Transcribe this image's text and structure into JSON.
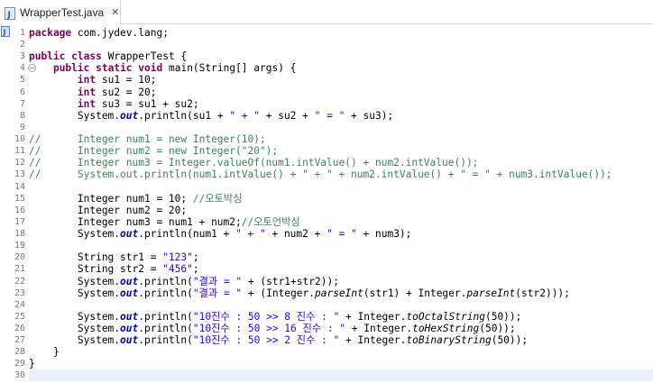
{
  "tab": {
    "title": "WrapperTest.java",
    "close_symbol": "✕",
    "icon": "java-file-icon"
  },
  "colors": {
    "keyword": "#7f0055",
    "string": "#2a00ff",
    "comment": "#3f7f5f",
    "field": "#0000c0",
    "current_line": "#e8f2fe"
  },
  "lines": [
    {
      "n": "1",
      "t": [
        {
          "c": "kw",
          "v": "package"
        },
        {
          "c": "",
          "v": " com.jydev.lang;"
        }
      ]
    },
    {
      "n": "2",
      "t": []
    },
    {
      "n": "3",
      "t": [
        {
          "c": "kw",
          "v": "public"
        },
        {
          "c": "",
          "v": " "
        },
        {
          "c": "kw",
          "v": "class"
        },
        {
          "c": "",
          "v": " WrapperTest {"
        }
      ]
    },
    {
      "n": "4",
      "fold": "⊖",
      "t": [
        {
          "c": "",
          "v": "    "
        },
        {
          "c": "kw",
          "v": "public"
        },
        {
          "c": "",
          "v": " "
        },
        {
          "c": "kw",
          "v": "static"
        },
        {
          "c": "",
          "v": " "
        },
        {
          "c": "kw",
          "v": "void"
        },
        {
          "c": "",
          "v": " main(String[] args) {"
        }
      ]
    },
    {
      "n": "5",
      "t": [
        {
          "c": "",
          "v": "        "
        },
        {
          "c": "kw",
          "v": "int"
        },
        {
          "c": "",
          "v": " su1 = 10;"
        }
      ]
    },
    {
      "n": "6",
      "t": [
        {
          "c": "",
          "v": "        "
        },
        {
          "c": "kw",
          "v": "int"
        },
        {
          "c": "",
          "v": " su2 = 20;"
        }
      ]
    },
    {
      "n": "7",
      "t": [
        {
          "c": "",
          "v": "        "
        },
        {
          "c": "kw",
          "v": "int"
        },
        {
          "c": "",
          "v": " su3 = su1 + su2;"
        }
      ]
    },
    {
      "n": "8",
      "t": [
        {
          "c": "",
          "v": "        System."
        },
        {
          "c": "fld",
          "v": "out"
        },
        {
          "c": "",
          "v": ".println(su1 + "
        },
        {
          "c": "str",
          "v": "\" + \""
        },
        {
          "c": "",
          "v": " + su2 + "
        },
        {
          "c": "str",
          "v": "\" = \""
        },
        {
          "c": "",
          "v": " + su3);"
        }
      ]
    },
    {
      "n": "9",
      "t": []
    },
    {
      "n": "10",
      "t": [
        {
          "c": "cm",
          "v": "//      Integer num1 = new Integer(10);"
        }
      ]
    },
    {
      "n": "11",
      "t": [
        {
          "c": "cm",
          "v": "//      Integer num2 = new Integer(\"20\");"
        }
      ]
    },
    {
      "n": "12",
      "t": [
        {
          "c": "cm",
          "v": "//      Integer num3 = Integer.valueOf(num1.intValue() + num2.intValue());"
        }
      ]
    },
    {
      "n": "13",
      "t": [
        {
          "c": "cm",
          "v": "//      System.out.println(num1.intValue() + \" + \" + num2.intValue() + \" = \" + num3.intValue());"
        }
      ]
    },
    {
      "n": "14",
      "t": []
    },
    {
      "n": "15",
      "t": [
        {
          "c": "",
          "v": "        Integer num1 = 10; "
        },
        {
          "c": "cm",
          "v": "//오토박싱"
        }
      ]
    },
    {
      "n": "16",
      "t": [
        {
          "c": "",
          "v": "        Integer num2 = 20;"
        }
      ]
    },
    {
      "n": "17",
      "t": [
        {
          "c": "",
          "v": "        Integer num3 = num1 + num2;"
        },
        {
          "c": "cm",
          "v": "//오토언박싱"
        }
      ]
    },
    {
      "n": "18",
      "t": [
        {
          "c": "",
          "v": "        System."
        },
        {
          "c": "fld",
          "v": "out"
        },
        {
          "c": "",
          "v": ".println(num1 + "
        },
        {
          "c": "str",
          "v": "\" + \""
        },
        {
          "c": "",
          "v": " + num2 + "
        },
        {
          "c": "str",
          "v": "\" = \""
        },
        {
          "c": "",
          "v": " + num3);"
        }
      ]
    },
    {
      "n": "19",
      "t": []
    },
    {
      "n": "20",
      "t": [
        {
          "c": "",
          "v": "        String str1 = "
        },
        {
          "c": "str",
          "v": "\"123\""
        },
        {
          "c": "",
          "v": ";"
        }
      ]
    },
    {
      "n": "21",
      "t": [
        {
          "c": "",
          "v": "        String str2 = "
        },
        {
          "c": "str",
          "v": "\"456\""
        },
        {
          "c": "",
          "v": ";"
        }
      ]
    },
    {
      "n": "22",
      "t": [
        {
          "c": "",
          "v": "        System."
        },
        {
          "c": "fld",
          "v": "out"
        },
        {
          "c": "",
          "v": ".println("
        },
        {
          "c": "str",
          "v": "\"결과 = \""
        },
        {
          "c": "",
          "v": " + (str1+str2));"
        }
      ]
    },
    {
      "n": "23",
      "t": [
        {
          "c": "",
          "v": "        System."
        },
        {
          "c": "fld",
          "v": "out"
        },
        {
          "c": "",
          "v": ".println("
        },
        {
          "c": "str",
          "v": "\"결과 = \""
        },
        {
          "c": "",
          "v": " + (Integer."
        },
        {
          "c": "sm",
          "v": "parseInt"
        },
        {
          "c": "",
          "v": "(str1) + Integer."
        },
        {
          "c": "sm",
          "v": "parseInt"
        },
        {
          "c": "",
          "v": "(str2)));"
        }
      ]
    },
    {
      "n": "24",
      "t": []
    },
    {
      "n": "25",
      "t": [
        {
          "c": "",
          "v": "        System."
        },
        {
          "c": "fld",
          "v": "out"
        },
        {
          "c": "",
          "v": ".println("
        },
        {
          "c": "str",
          "v": "\"10진수 : 50 >> 8 진수 : \""
        },
        {
          "c": "",
          "v": " + Integer."
        },
        {
          "c": "sm",
          "v": "toOctalString"
        },
        {
          "c": "",
          "v": "(50));"
        }
      ]
    },
    {
      "n": "26",
      "t": [
        {
          "c": "",
          "v": "        System."
        },
        {
          "c": "fld",
          "v": "out"
        },
        {
          "c": "",
          "v": ".println("
        },
        {
          "c": "str",
          "v": "\"10진수 : 50 >> 16 진수 : \""
        },
        {
          "c": "",
          "v": " + Integer."
        },
        {
          "c": "sm",
          "v": "toHexString"
        },
        {
          "c": "",
          "v": "(50));"
        }
      ]
    },
    {
      "n": "27",
      "t": [
        {
          "c": "",
          "v": "        System."
        },
        {
          "c": "fld",
          "v": "out"
        },
        {
          "c": "",
          "v": ".println("
        },
        {
          "c": "str",
          "v": "\"10진수 : 50 >> 2 진수 : \""
        },
        {
          "c": "",
          "v": " + Integer."
        },
        {
          "c": "sm",
          "v": "toBinaryString"
        },
        {
          "c": "",
          "v": "(50));"
        }
      ]
    },
    {
      "n": "28",
      "t": [
        {
          "c": "",
          "v": "    }"
        }
      ]
    },
    {
      "n": "29",
      "t": [
        {
          "c": "",
          "v": "}"
        }
      ]
    },
    {
      "n": "30",
      "cur": true,
      "t": []
    }
  ]
}
